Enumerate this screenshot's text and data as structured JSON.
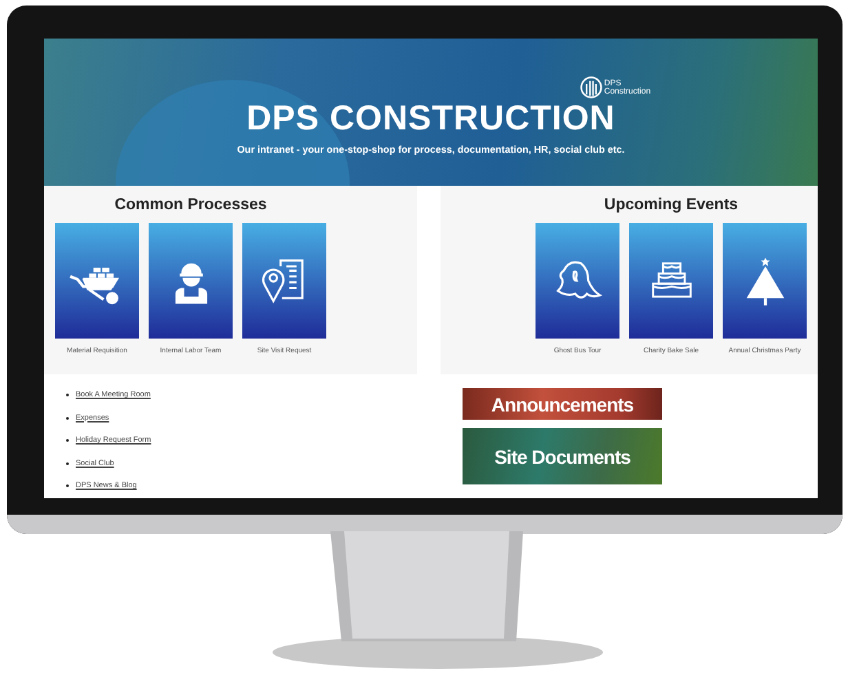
{
  "hero": {
    "title": "DPS CONSTRUCTION",
    "tagline": "Our intranet - your one-stop-shop for process, documentation, HR, social club etc.",
    "logo_lines": [
      "DPS",
      "Construction"
    ]
  },
  "processes": {
    "title": "Common Processes",
    "items": [
      {
        "label": "Material Requisition",
        "kind": "wheelbarrow"
      },
      {
        "label": "Internal Labor Team",
        "kind": "worker"
      },
      {
        "label": "Site Visit Request",
        "kind": "location"
      }
    ]
  },
  "events": {
    "title": "Upcoming Events",
    "items": [
      {
        "label": "Ghost Bus Tour",
        "kind": "ghost"
      },
      {
        "label": "Charity Bake Sale",
        "kind": "cake"
      },
      {
        "label": "Annual Christmas Party",
        "kind": "tree"
      }
    ]
  },
  "links": [
    "Book A Meeting Room",
    "Expenses",
    "Holiday Request Form",
    "Social Club",
    "DPS News & Blog"
  ],
  "banners": [
    {
      "label": "Announcements",
      "kind": "red"
    },
    {
      "label": "Site Documents",
      "kind": "green"
    }
  ]
}
